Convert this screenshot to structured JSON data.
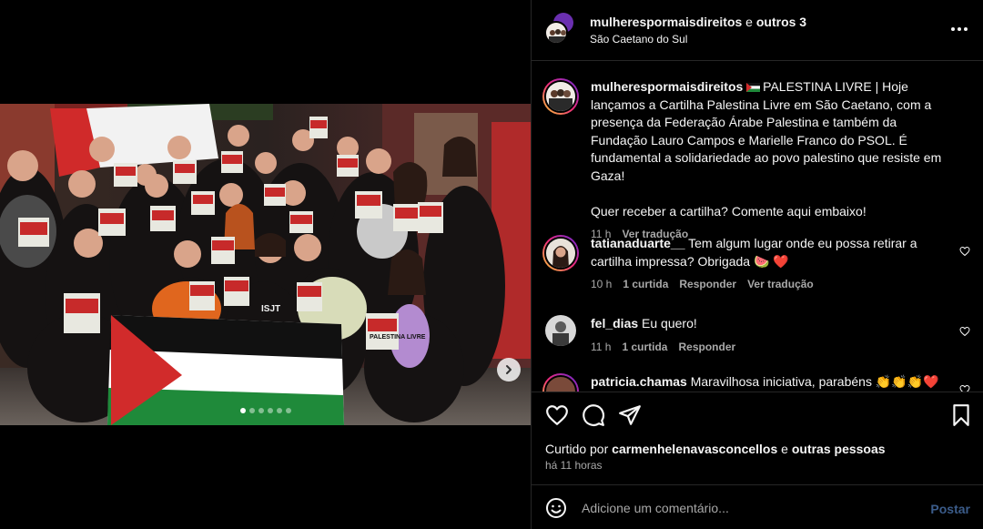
{
  "post": {
    "header": {
      "username": "mulherespormaisdireitos",
      "connector": "e",
      "others": "outros 3",
      "location": "São Caetano do Sul"
    },
    "photo": {
      "sign_text": "PALESTINA LIVRE",
      "shirt_text": "ISJT"
    },
    "carousel": {
      "count": 6,
      "active_index": 0
    },
    "caption": {
      "username": "mulherespormaisdireitos",
      "text": "PALESTINA LIVRE | Hoje lançamos a Cartilha Palestina Livre em São Caetano, com a presença da Federação Árabe Palestina e também da Fundação Lauro Campos e Marielle Franco do PSOL. É fundamental a solidariedade ao povo palestino que resiste em Gaza!",
      "text2": "Quer receber a cartilha? Comente aqui embaixo!",
      "time": "11 h",
      "translate": "Ver tradução"
    },
    "comments": [
      {
        "username": "tatianaduarte__",
        "text": "Tem algum lugar onde eu possa retirar a cartilha impressa? Obrigada 🍉 ❤️",
        "time": "10 h",
        "likes": "1 curtida",
        "reply": "Responder",
        "translate": "Ver tradução"
      },
      {
        "username": "fel_dias",
        "text": "Eu quero!",
        "time": "11 h",
        "likes": "1 curtida",
        "reply": "Responder"
      },
      {
        "username": "patricia.chamas",
        "text": "Maravilhosa iniciativa, parabéns 👏👏👏❤️"
      }
    ],
    "liked_by": {
      "prefix": "Curtido por",
      "user": "carmenhelenavasconcellos",
      "conj": "e",
      "others": "outras pessoas"
    },
    "timestamp": "há 11 horas",
    "add_comment": {
      "placeholder": "Adicione um comentário...",
      "post_label": "Postar"
    }
  },
  "colors": {
    "background": "#000000",
    "divider": "#262626",
    "text": "#f5f5f5",
    "secondary_text": "#a8a8a8",
    "post_button_disabled": "#3b5c8a",
    "heart_red": "#ed4956"
  },
  "icons": [
    "more-icon",
    "heart-icon",
    "comment-icon",
    "share-icon",
    "bookmark-icon",
    "emoji-icon",
    "chevron-right-icon",
    "user-tag-icon"
  ]
}
